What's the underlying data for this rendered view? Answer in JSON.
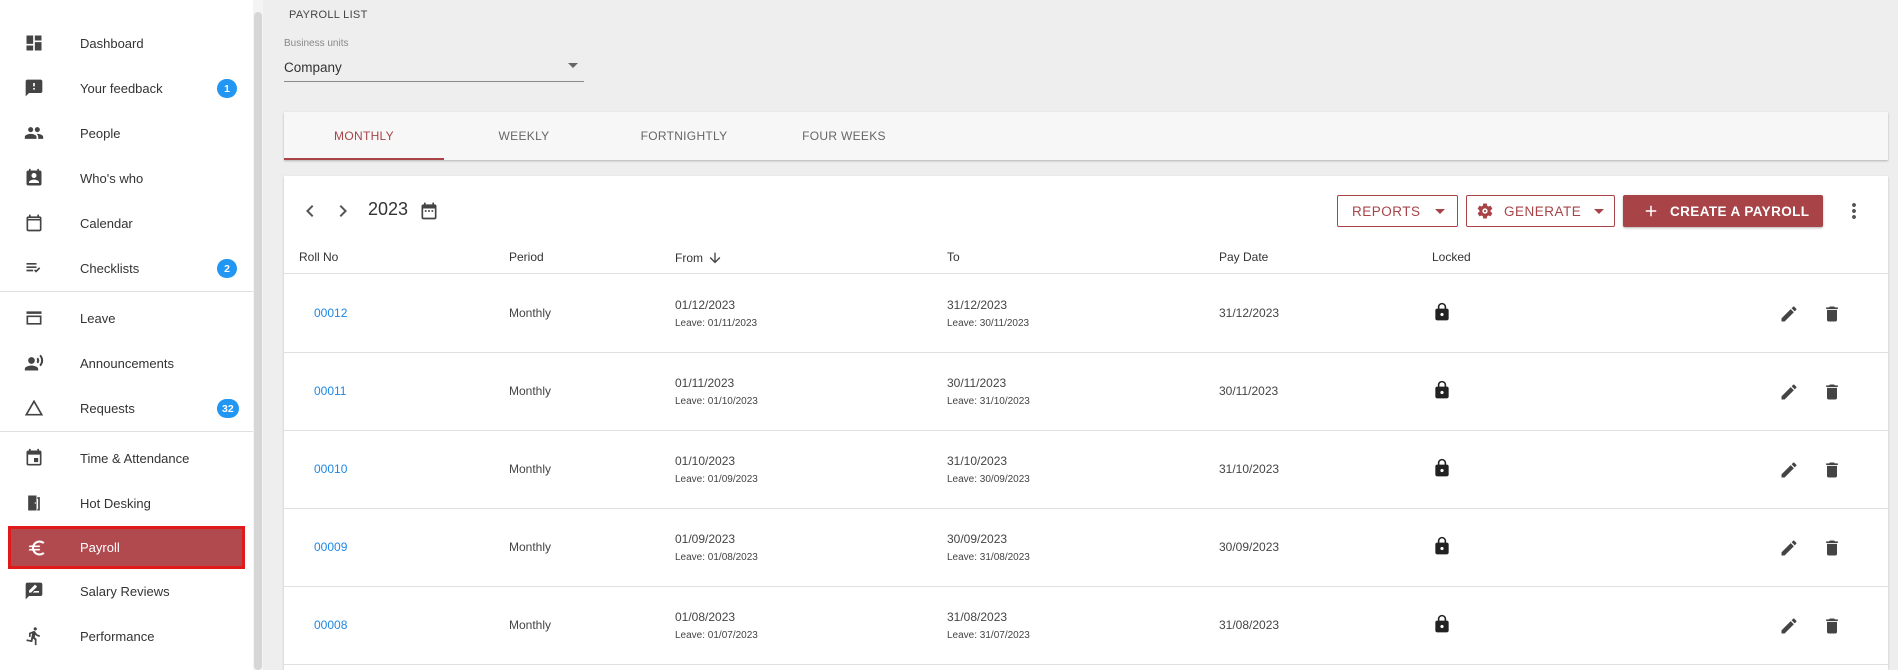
{
  "sidebar": {
    "groups": [
      [
        {
          "label": "Dashboard",
          "icon": "dashboard-icon"
        },
        {
          "label": "Your feedback",
          "icon": "feedback-icon",
          "badge": "1"
        },
        {
          "label": "People",
          "icon": "people-icon"
        },
        {
          "label": "Who's who",
          "icon": "contact-icon"
        },
        {
          "label": "Calendar",
          "icon": "calendar-icon"
        },
        {
          "label": "Checklists",
          "icon": "checklist-icon",
          "badge": "2"
        }
      ],
      [
        {
          "label": "Leave",
          "icon": "leave-icon"
        },
        {
          "label": "Announcements",
          "icon": "announcement-icon"
        },
        {
          "label": "Requests",
          "icon": "warning-triangle-icon",
          "badge": "32"
        }
      ],
      [
        {
          "label": "Time & Attendance",
          "icon": "time-attendance-icon"
        },
        {
          "label": "Hot Desking",
          "icon": "door-icon"
        },
        {
          "label": "Payroll",
          "icon": "euro-icon",
          "active": true
        },
        {
          "label": "Salary Reviews",
          "icon": "rate-review-icon"
        },
        {
          "label": "Performance",
          "icon": "running-icon"
        }
      ]
    ]
  },
  "header": {
    "page_title": "PAYROLL LIST",
    "business_units": {
      "label": "Business units",
      "value": "Company"
    }
  },
  "tabs": [
    {
      "label": "MONTHLY",
      "active": true
    },
    {
      "label": "WEEKLY"
    },
    {
      "label": "FORTNIGHTLY"
    },
    {
      "label": "FOUR WEEKS"
    }
  ],
  "toolbar": {
    "year": "2023",
    "reports_label": "REPORTS",
    "generate_label": "GENERATE",
    "create_label": "CREATE A PAYROLL"
  },
  "table": {
    "columns": {
      "roll": "Roll No",
      "period": "Period",
      "from": "From",
      "to": "To",
      "paydate": "Pay Date",
      "locked": "Locked"
    },
    "rows": [
      {
        "roll": "00012",
        "period": "Monthly",
        "from": "01/12/2023",
        "from_leave": "Leave: 01/11/2023",
        "to": "31/12/2023",
        "to_leave": "Leave: 30/11/2023",
        "paydate": "31/12/2023"
      },
      {
        "roll": "00011",
        "period": "Monthly",
        "from": "01/11/2023",
        "from_leave": "Leave: 01/10/2023",
        "to": "30/11/2023",
        "to_leave": "Leave: 31/10/2023",
        "paydate": "30/11/2023"
      },
      {
        "roll": "00010",
        "period": "Monthly",
        "from": "01/10/2023",
        "from_leave": "Leave: 01/09/2023",
        "to": "31/10/2023",
        "to_leave": "Leave: 30/09/2023",
        "paydate": "31/10/2023"
      },
      {
        "roll": "00009",
        "period": "Monthly",
        "from": "01/09/2023",
        "from_leave": "Leave: 01/08/2023",
        "to": "30/09/2023",
        "to_leave": "Leave: 31/08/2023",
        "paydate": "30/09/2023"
      },
      {
        "roll": "00008",
        "period": "Monthly",
        "from": "01/08/2023",
        "from_leave": "Leave: 01/07/2023",
        "to": "31/08/2023",
        "to_leave": "Leave: 31/07/2023",
        "paydate": "31/08/2023"
      }
    ]
  },
  "colors": {
    "accent": "#a84448",
    "link": "#1e88e5",
    "badge": "#2196f3",
    "active_border": "#e01a1a"
  }
}
